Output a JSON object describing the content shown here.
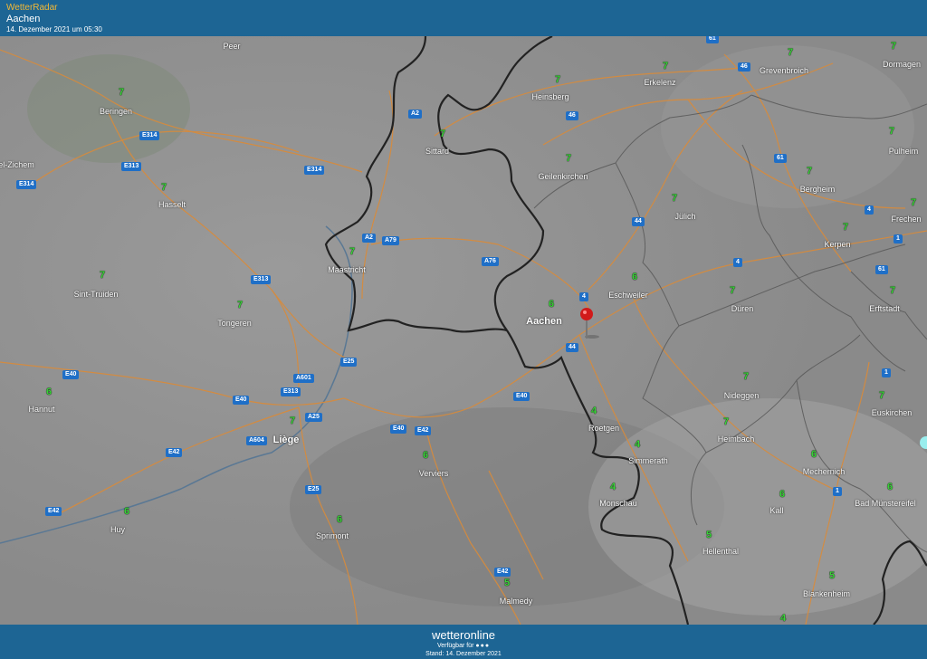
{
  "header": {
    "app_name": "WetterRadar",
    "location": "Aachen",
    "datetime": "14. Dezember 2021 um 05:30"
  },
  "footer": {
    "logo": "wetteronline",
    "available_for": "Verfügbar für",
    "stand": "Stand: 14. Dezember 2021"
  },
  "cities": {
    "peer": "Peer",
    "beringen": "Beringen",
    "zichem": "el-Zichem",
    "hasselt": "Hasselt",
    "sint_truiden": "Sint-Truiden",
    "tongeren": "Tongeren",
    "hannut": "Hannut",
    "huy": "Huy",
    "liege": "Liège",
    "maastricht": "Maastricht",
    "sittard": "Sittard",
    "heinsberg": "Heinsberg",
    "erkelenz": "Erkelenz",
    "grevenbroich": "Grevenbroich",
    "dormagen": "Dormagen",
    "pulheim": "Pulheim",
    "geilenkirchen": "Geilenkirchen",
    "bergheim": "Bergheim",
    "julich": "Jülich",
    "frechen": "Frechen",
    "kerpen": "Kerpen",
    "eschweiler": "Eschweiler",
    "aachen": "Aachen",
    "duren": "Düren",
    "erftstadt": "Erftstadt",
    "nideggen": "Nideggen",
    "euskirchen": "Euskirchen",
    "roetgen": "Roetgen",
    "heimbach": "Heimbach",
    "simmerath": "Simmerath",
    "mechernich": "Mechernich",
    "monschau": "Monschau",
    "kall": "Kall",
    "bad_munstereifel": "Bad Münstereifel",
    "verviers": "Verviers",
    "sprimont": "Sprimont",
    "hellenthal": "Hellenthal",
    "blankenheim": "Blankenheim",
    "malmedy": "Malmedy"
  },
  "temps": {
    "beringen": "7",
    "hasselt": "7",
    "sint_truiden": "7",
    "tongeren": "7",
    "hannut": "6",
    "huy": "6",
    "liege": "7",
    "maastricht": "7",
    "sittard": "7",
    "heinsberg": "7",
    "erkelenz": "7",
    "grevenbroich": "7",
    "dormagen": "7",
    "pulheim": "7",
    "geilenkirchen": "7",
    "bergheim": "7",
    "julich": "7",
    "frechen": "7",
    "kerpen": "7",
    "eschweiler": "6",
    "aachen": "6",
    "duren": "7",
    "erftstadt": "7",
    "nideggen": "7",
    "euskirchen": "7",
    "roetgen": "4",
    "heimbach": "7",
    "simmerath": "4",
    "mechernich": "6",
    "monschau": "4",
    "kall": "6",
    "bad_munstereifel": "6",
    "verviers": "6",
    "sprimont": "6",
    "hellenthal": "5",
    "blankenheim": "5",
    "malmedy": "5",
    "bottom_right": "4"
  },
  "roads": {
    "e314_a": "E314",
    "e313_a": "E313",
    "e314_b": "E314",
    "e314_c": "E314",
    "a2_a": "A2",
    "a2_b": "A2",
    "a79": "A79",
    "a76": "A76",
    "e313_b": "E313",
    "e25_a": "E25",
    "a601": "A601",
    "e40_a": "E40",
    "e40_b": "E40",
    "e313_c": "E313",
    "a25": "A25",
    "a604": "A604",
    "e42_a": "E42",
    "e40_c": "E40",
    "e42_b": "E42",
    "e40_d": "E40",
    "e42_c": "E42",
    "e25_b": "E25",
    "e42_d": "E42",
    "r61_a": "61",
    "r46_a": "46",
    "r46_b": "46",
    "r61_b": "61",
    "r44_a": "44",
    "r4_a": "4",
    "r4_b": "4",
    "r4_c": "4",
    "r44_b": "44",
    "r61_c": "61",
    "r1_a": "1",
    "r1_b": "1",
    "r1_c": "1"
  },
  "colors": {
    "header_bg": "#1d6594",
    "app_name": "#f2b836",
    "temperature": "#39d438",
    "road_badge": "#1f6fc7",
    "pin": "#d11a1a"
  }
}
